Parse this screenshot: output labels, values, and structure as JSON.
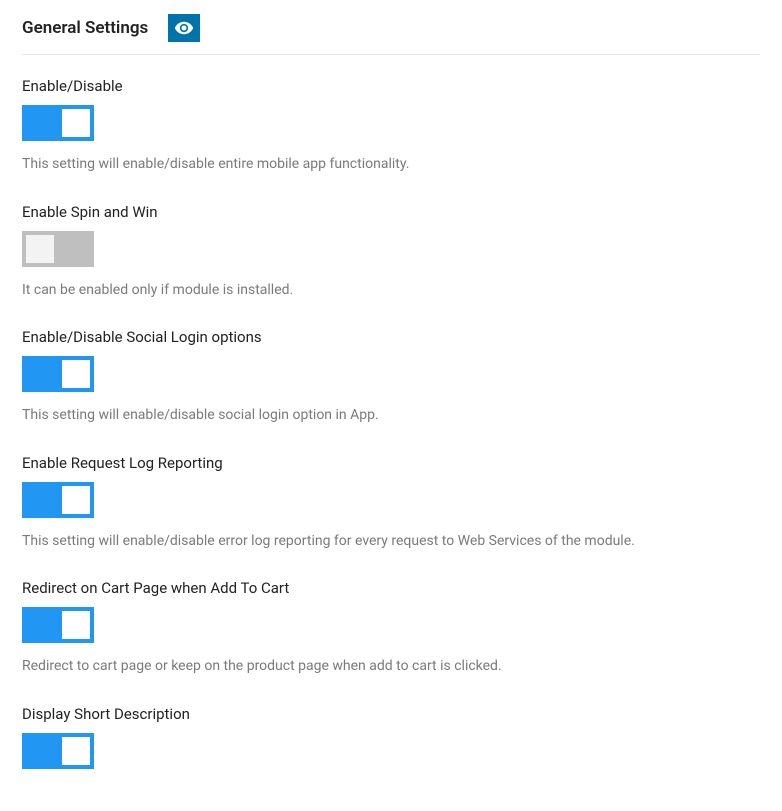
{
  "header": {
    "title": "General Settings"
  },
  "settings": [
    {
      "label": "Enable/Disable",
      "state": "on",
      "description": "This setting will enable/disable entire mobile app functionality."
    },
    {
      "label": "Enable Spin and Win",
      "state": "disabled",
      "description": "It can be enabled only if module is installed."
    },
    {
      "label": "Enable/Disable Social Login options",
      "state": "on",
      "description": "This setting will enable/disable social login option in App."
    },
    {
      "label": "Enable Request Log Reporting",
      "state": "on",
      "description": "This setting will enable/disable error log reporting for every request to Web Services of the module."
    },
    {
      "label": "Redirect on Cart Page when Add To Cart",
      "state": "on",
      "description": "Redirect to cart page or keep on the product page when add to cart is clicked."
    },
    {
      "label": "Display Short Description",
      "state": "on",
      "description": ""
    }
  ]
}
